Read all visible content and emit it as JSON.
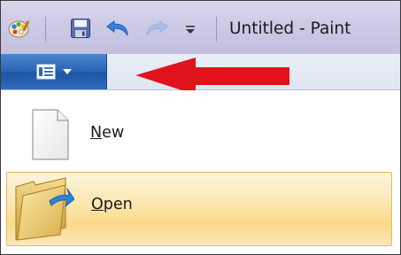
{
  "window": {
    "title": "Untitled - Paint"
  },
  "quick_access": {
    "items": [
      {
        "icon": "paint-app-icon"
      },
      {
        "icon": "save-icon"
      },
      {
        "icon": "undo-icon"
      },
      {
        "icon": "redo-icon"
      },
      {
        "icon": "customize-dropdown-icon"
      }
    ]
  },
  "ribbon": {
    "paint_button_icon": "paint-menu-icon",
    "annotation": "red-arrow-pointing-left"
  },
  "menu": {
    "items": [
      {
        "label_first": "N",
        "label_rest": "ew",
        "icon": "new-document-icon"
      },
      {
        "label_first": "O",
        "label_rest": "pen",
        "icon": "open-folder-icon",
        "highlighted": true
      }
    ]
  },
  "colors": {
    "titlebar": "#cdcae6",
    "paint_button": "#2b66b8",
    "highlight": "#fad98a",
    "arrow": "#e0131c"
  }
}
